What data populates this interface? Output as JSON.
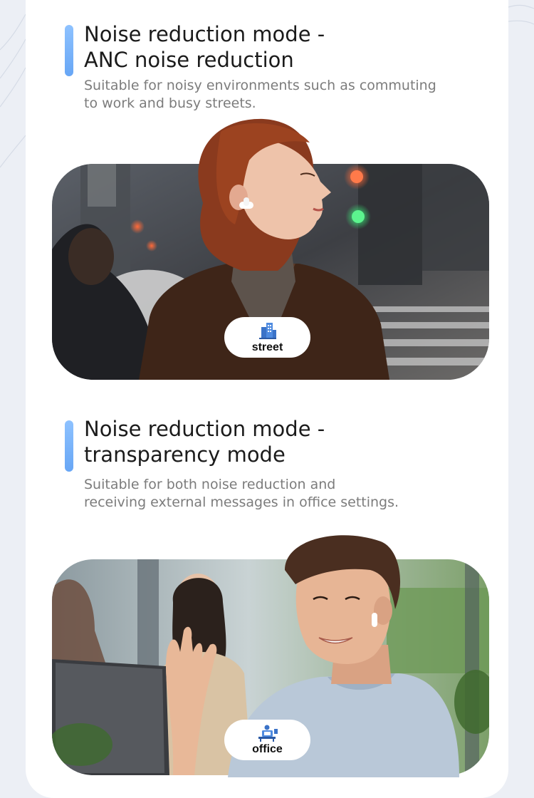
{
  "sections": [
    {
      "title_lines": [
        "Noise reduction mode -",
        "ANC noise reduction"
      ],
      "desc_lines": [
        "Suitable for noisy environments such as commuting",
        "to work and busy streets."
      ],
      "badge": {
        "icon": "building-icon",
        "label": "street"
      },
      "photo": "woman-with-earbuds-on-city-street"
    },
    {
      "title_lines": [
        "Noise reduction mode -",
        "transparency mode"
      ],
      "desc_lines": [
        "Suitable for both noise reduction and",
        "receiving external messages in office settings."
      ],
      "badge": {
        "icon": "office-desk-icon",
        "label": "office"
      },
      "photo": "man-with-earbuds-in-office"
    }
  ],
  "colors": {
    "accent": "#7ab4fa",
    "background": "#eceff5",
    "card": "#ffffff",
    "heading": "#1b1b1b",
    "description": "#7c7c7c",
    "icon": "#3b73c8"
  }
}
